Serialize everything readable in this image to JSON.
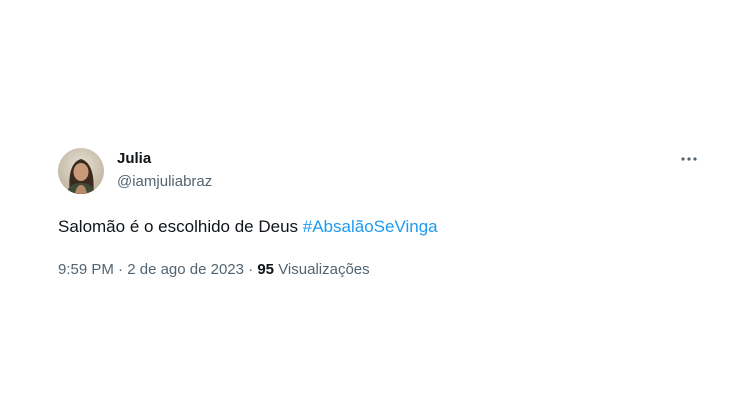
{
  "user": {
    "name": "Julia",
    "handle": "@iamjuliabraz"
  },
  "tweet": {
    "text": "Salomão é o escolhido de Deus ",
    "hashtag": "#AbsalãoSeVinga"
  },
  "meta": {
    "time": "9:59 PM",
    "separator1": " · ",
    "date": "2 de ago de 2023",
    "separator2": " · ",
    "views_count": "95",
    "views_label": " Visualizações"
  },
  "icons": {
    "more": "more-horizontal-icon",
    "avatar": "avatar-photo"
  },
  "colors": {
    "text_primary": "#0f1419",
    "text_secondary": "#536471",
    "link": "#1d9bf0"
  }
}
